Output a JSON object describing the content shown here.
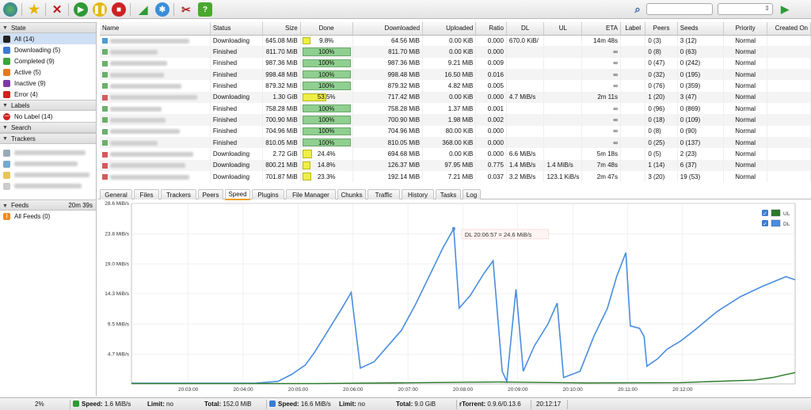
{
  "toolbar": {
    "buttons": [
      "globe-icon",
      "star-icon",
      "delete-icon",
      "start-icon",
      "pause-icon",
      "stop-icon",
      "rss-icon",
      "settings-icon",
      "tools-icon",
      "help-icon"
    ],
    "search_placeholder": ""
  },
  "sidebar": {
    "state_header": "State",
    "state_items": [
      {
        "label": "All (14)",
        "icon": "all-icon",
        "color": "#222222"
      },
      {
        "label": "Downloading (5)",
        "icon": "downloading-icon",
        "color": "#3a7bd5"
      },
      {
        "label": "Completed (9)",
        "icon": "completed-icon",
        "color": "#3aa53a"
      },
      {
        "label": "Active (5)",
        "icon": "active-icon",
        "color": "#e07b1f"
      },
      {
        "label": "Inactive (9)",
        "icon": "inactive-icon",
        "color": "#7a3aa5"
      },
      {
        "label": "Error (4)",
        "icon": "error-icon",
        "color": "#d02020"
      }
    ],
    "labels_header": "Labels",
    "label_items": [
      {
        "label": "No Label (14)"
      }
    ],
    "search_header": "Search",
    "trackers_header": "Trackers",
    "feeds_header": "Feeds",
    "feeds_timer": "20m 39s",
    "feed_items": [
      {
        "label": "All Feeds (0)"
      }
    ]
  },
  "torrents": {
    "columns": [
      "Name",
      "Status",
      "Size",
      "Done",
      "Downloaded",
      "Uploaded",
      "Ratio",
      "DL",
      "UL",
      "ETA",
      "Label",
      "Peers",
      "Seeds",
      "Priority",
      "Created On"
    ],
    "rows": [
      {
        "status": "Downloading",
        "size": "645.08 MiB",
        "done": "9.8%",
        "done_pct": 9.8,
        "downloaded": "64.56 MiB",
        "uploaded": "0.00 KiB",
        "ratio": "0.000",
        "dl": "670.0 KiB/",
        "ul": "",
        "eta": "14m 48s",
        "peers": "0 (3)",
        "seeds": "3 (12)",
        "priority": "Normal"
      },
      {
        "status": "Finished",
        "size": "811.70 MiB",
        "done": "100%",
        "done_pct": 100,
        "downloaded": "811.70 MiB",
        "uploaded": "0.00 KiB",
        "ratio": "0.000",
        "dl": "",
        "ul": "",
        "eta": "∞",
        "peers": "0 (8)",
        "seeds": "0 (63)",
        "priority": "Normal"
      },
      {
        "status": "Finished",
        "size": "987.36 MiB",
        "done": "100%",
        "done_pct": 100,
        "downloaded": "987.36 MiB",
        "uploaded": "9.21 MiB",
        "ratio": "0.009",
        "dl": "",
        "ul": "",
        "eta": "∞",
        "peers": "0 (47)",
        "seeds": "0 (242)",
        "priority": "Normal"
      },
      {
        "status": "Finished",
        "size": "998.48 MiB",
        "done": "100%",
        "done_pct": 100,
        "downloaded": "998.48 MiB",
        "uploaded": "16.50 MiB",
        "ratio": "0.016",
        "dl": "",
        "ul": "",
        "eta": "∞",
        "peers": "0 (32)",
        "seeds": "0 (195)",
        "priority": "Normal"
      },
      {
        "status": "Finished",
        "size": "879.32 MiB",
        "done": "100%",
        "done_pct": 100,
        "downloaded": "879.32 MiB",
        "uploaded": "4.82 MiB",
        "ratio": "0.005",
        "dl": "",
        "ul": "",
        "eta": "∞",
        "peers": "0 (76)",
        "seeds": "0 (359)",
        "priority": "Normal"
      },
      {
        "status": "Downloading",
        "size": "1.30 GiB",
        "done": "53.5%",
        "done_pct": 53.5,
        "downloaded": "717.42 MiB",
        "uploaded": "0.00 KiB",
        "ratio": "0.000",
        "dl": "4.7 MiB/s",
        "ul": "",
        "eta": "2m 11s",
        "peers": "1 (20)",
        "seeds": "3 (47)",
        "priority": "Normal"
      },
      {
        "status": "Finished",
        "size": "758.28 MiB",
        "done": "100%",
        "done_pct": 100,
        "downloaded": "758.28 MiB",
        "uploaded": "1.37 MiB",
        "ratio": "0.001",
        "dl": "",
        "ul": "",
        "eta": "∞",
        "peers": "0 (96)",
        "seeds": "0 (869)",
        "priority": "Normal"
      },
      {
        "status": "Finished",
        "size": "700.90 MiB",
        "done": "100%",
        "done_pct": 100,
        "downloaded": "700.90 MiB",
        "uploaded": "1.98 MiB",
        "ratio": "0.002",
        "dl": "",
        "ul": "",
        "eta": "∞",
        "peers": "0 (18)",
        "seeds": "0 (109)",
        "priority": "Normal"
      },
      {
        "status": "Finished",
        "size": "704.96 MiB",
        "done": "100%",
        "done_pct": 100,
        "downloaded": "704.96 MiB",
        "uploaded": "80.00 KiB",
        "ratio": "0.000",
        "dl": "",
        "ul": "",
        "eta": "∞",
        "peers": "0 (8)",
        "seeds": "0 (90)",
        "priority": "Normal"
      },
      {
        "status": "Finished",
        "size": "810.05 MiB",
        "done": "100%",
        "done_pct": 100,
        "downloaded": "810.05 MiB",
        "uploaded": "368.00 KiB",
        "ratio": "0.000",
        "dl": "",
        "ul": "",
        "eta": "∞",
        "peers": "0 (25)",
        "seeds": "0 (137)",
        "priority": "Normal"
      },
      {
        "status": "Downloading",
        "size": "2.72 GiB",
        "done": "24.4%",
        "done_pct": 24.4,
        "downloaded": "694.68 MiB",
        "uploaded": "0.00 KiB",
        "ratio": "0.000",
        "dl": "6.6 MiB/s",
        "ul": "",
        "eta": "5m 18s",
        "peers": "0 (5)",
        "seeds": "2 (23)",
        "priority": "Normal"
      },
      {
        "status": "Downloading",
        "size": "800.21 MiB",
        "done": "14.8%",
        "done_pct": 14.8,
        "downloaded": "126.37 MiB",
        "uploaded": "97.95 MiB",
        "ratio": "0.775",
        "dl": "1.4 MiB/s",
        "ul": "1.4 MiB/s",
        "eta": "7m 48s",
        "peers": "1 (14)",
        "seeds": "6 (37)",
        "priority": "Normal"
      },
      {
        "status": "Downloading",
        "size": "701.87 MiB",
        "done": "23.3%",
        "done_pct": 23.3,
        "downloaded": "192.14 MiB",
        "uploaded": "7.21 MiB",
        "ratio": "0.037",
        "dl": "3.2 MiB/s",
        "ul": "123.1 KiB/s",
        "eta": "2m 47s",
        "peers": "3 (20)",
        "seeds": "19 (53)",
        "priority": "Normal"
      }
    ]
  },
  "tabs": [
    "General",
    "Files",
    "Trackers",
    "Peers",
    "Speed",
    "Plugins",
    "File Manager",
    "Chunks",
    "Traffic",
    "History",
    "Tasks",
    "Log"
  ],
  "active_tab": "Speed",
  "chart_data": {
    "type": "line",
    "y_ticks": [
      "4.7 MiB/s",
      "9.5 MiB/s",
      "14.3 MiB/s",
      "19.0 MiB/s",
      "23.8 MiB/s",
      "28.6 MiB/s"
    ],
    "x_ticks": [
      "20:03:00",
      "20:04:00",
      "20:05:00",
      "20:06:00",
      "20:07:00",
      "20:08:00",
      "20:09:00",
      "20:10:00",
      "20:11:00",
      "20:12:00"
    ],
    "ylim": [
      0,
      28.6
    ],
    "xlim_seconds": [
      0,
      590
    ],
    "legend": [
      "UL",
      "DL"
    ],
    "series": [
      {
        "name": "DL",
        "color": "#4a8de0",
        "points": [
          [
            0,
            0.1
          ],
          [
            100,
            0.1
          ],
          [
            135,
            0.1
          ],
          [
            160,
            0.4
          ],
          [
            175,
            1.5
          ],
          [
            190,
            3.0
          ],
          [
            200,
            5.0
          ],
          [
            215,
            8.5
          ],
          [
            230,
            12.0
          ],
          [
            240,
            14.5
          ],
          [
            250,
            2.5
          ],
          [
            265,
            3.5
          ],
          [
            280,
            6.0
          ],
          [
            295,
            8.5
          ],
          [
            310,
            12.5
          ],
          [
            325,
            17.0
          ],
          [
            340,
            21.5
          ],
          [
            352,
            24.6
          ],
          [
            358,
            12.0
          ],
          [
            370,
            14.0
          ],
          [
            385,
            17.5
          ],
          [
            395,
            19.5
          ],
          [
            405,
            2.0
          ],
          [
            410,
            0.4
          ],
          [
            420,
            15.0
          ],
          [
            428,
            2.0
          ],
          [
            440,
            6.0
          ],
          [
            455,
            9.5
          ],
          [
            465,
            12.8
          ],
          [
            472,
            1.0
          ],
          [
            490,
            2.0
          ],
          [
            505,
            7.5
          ],
          [
            520,
            12.0
          ],
          [
            530,
            17.0
          ],
          [
            540,
            20.8
          ],
          [
            545,
            9.2
          ],
          [
            555,
            8.8
          ],
          [
            560,
            7.5
          ],
          [
            563,
            2.8
          ],
          [
            575,
            4.0
          ],
          [
            585,
            5.5
          ],
          [
            600,
            6.8
          ],
          [
            615,
            8.5
          ],
          [
            640,
            11.5
          ],
          [
            665,
            13.8
          ],
          [
            690,
            15.5
          ],
          [
            715,
            17.0
          ],
          [
            725,
            16.5
          ]
        ]
      },
      {
        "name": "UL",
        "color": "#2a7a2a",
        "points": [
          [
            0,
            0.05
          ],
          [
            200,
            0.05
          ],
          [
            400,
            0.3
          ],
          [
            500,
            0.15
          ],
          [
            600,
            0.2
          ],
          [
            680,
            0.6
          ],
          [
            700,
            1.0
          ],
          [
            725,
            1.8
          ]
        ]
      }
    ],
    "annotation": "DL 20:06:57 = 24.6 MiB/s"
  },
  "status": {
    "percent": "2%",
    "dl_speed_label": "Speed:",
    "dl_speed": "1.6 MiB/s",
    "dl_limit_label": "Limit:",
    "dl_limit": "no",
    "dl_total_label": "Total:",
    "dl_total": "152.0 MiB",
    "ul_speed_label": "Speed:",
    "ul_speed": "16.6 MiB/s",
    "ul_limit_label": "Limit:",
    "ul_limit": "no",
    "ul_total_label": "Total:",
    "ul_total": "9.0 GiB",
    "client_label": "rTorrent:",
    "client_version": "0.9.6/0.13.6",
    "time": "20:12:17"
  }
}
